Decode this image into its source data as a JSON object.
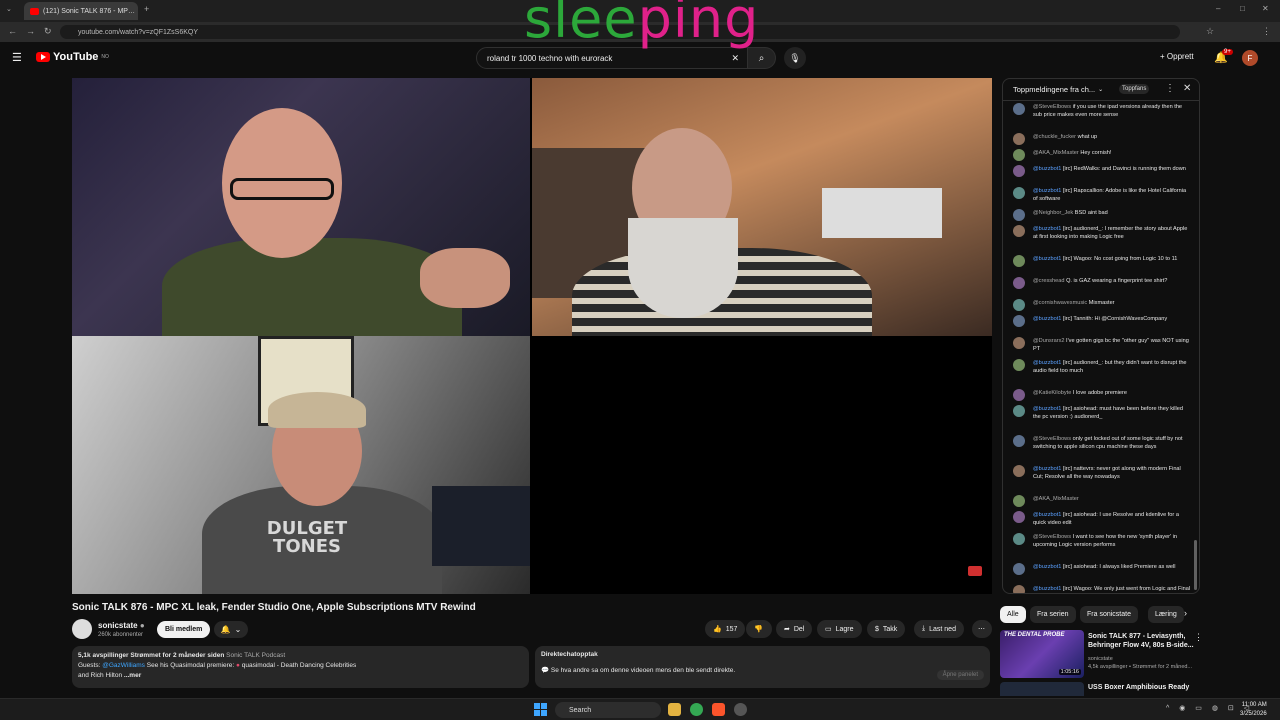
{
  "browser": {
    "tab_title": "(121) Sonic TALK 876 - MP…",
    "url": "youtube.com/watch?v=zQF1ZsS6KQY"
  },
  "overlay_text": {
    "part1": "slee",
    "part2": "ping"
  },
  "youtube": {
    "logo": "YouTube",
    "logo_region": "NO",
    "search_query": "roland tr 1000 techno with eurorack",
    "create_label": "Opprett",
    "notif_badge": "9+",
    "avatar_letter": "F"
  },
  "video": {
    "title": "Sonic TALK 876 - MPC XL leak, Fender Studio One, Apple Subscriptions MTV Rewind",
    "channel": "sonicstate",
    "subscribers": "260k abonnenter",
    "join_label": "Bli medlem",
    "likes": "157",
    "actions": {
      "share": "Del",
      "save": "Lagre",
      "thanks": "Takk",
      "download": "Last ned"
    }
  },
  "description": {
    "stats": "5,1k avspillinger  Strømmet for 2 måneder siden",
    "playlist": "Sonic TALK Podcast",
    "guests_label": "Guests:",
    "guest1": "@GazWilliams",
    "see_his": " See his Quasimodal premiere: ",
    "quasi": "quasimodal - Death Dancing Celebrities",
    "guest2_line": "and Rich Hilton",
    "more": "...mer"
  },
  "live_chat_replay": {
    "heading": "Direktechatopptak",
    "text": "Se hva andre sa om denne videoen mens den ble sendt direkte.",
    "open_label": "Åpne panelet"
  },
  "chat": {
    "header": "Toppmeldingene fra ch...",
    "fans_label": "Toppfans",
    "messages": [
      {
        "user": "@SteveElbows",
        "text": "if you use the ipad versions already then the sub price makes even more sense",
        "blue": false
      },
      {
        "user": "@chuckle_fucker",
        "text": "what up",
        "blue": false
      },
      {
        "user": "@AKA_MixMaster",
        "text": "Hey cornish!",
        "blue": false
      },
      {
        "user": "@buzzbot1",
        "text": "[irc] RedWalks: and Davinci is running them down",
        "blue": true
      },
      {
        "user": "@buzzbot1",
        "text": "[irc] Rapscallion: Adobe is like the Hotel California of software",
        "blue": true
      },
      {
        "user": "@Neighbor_Jek",
        "text": "BSD aint bad",
        "blue": false
      },
      {
        "user": "@buzzbot1",
        "text": "[irc] audionerd_: I remember the story about Apple at first looking into making Logic free",
        "blue": true
      },
      {
        "user": "@buzzbot1",
        "text": "[irc] Wagoo: No cost going from Logic 10 to 11",
        "blue": true
      },
      {
        "user": "@cresshead",
        "text": "Q. is GAZ wearing a fingerprint tee shirt?",
        "blue": false
      },
      {
        "user": "@cornishwavesmusic",
        "text": "Mixmaster",
        "blue": false
      },
      {
        "user": "@buzzbot1",
        "text": "[irc] Tannith: Hi @CornishWavesCompany",
        "blue": true
      },
      {
        "user": "@Dunsrarx2",
        "text": "I've gotten gigs bc the \"other guy\" was NOT using PT",
        "blue": false
      },
      {
        "user": "@buzzbot1",
        "text": "[irc] audionerd_: but they didn't want to disrupt the audio field too much",
        "blue": true
      },
      {
        "user": "@KatieKilobyte",
        "text": "I love adobe premiere",
        "blue": false
      },
      {
        "user": "@buzzbot1",
        "text": "[irc] asiohead: must have been before they killed the pc version :) audionerd_",
        "blue": true
      },
      {
        "user": "@SteveElbows",
        "text": "only get locked out of some logic stuff by not switching to apple silicon cpu machine these days",
        "blue": false
      },
      {
        "user": "@buzzbot1",
        "text": "[irc] nattevrs: never got along with modern Final Cut; Resolve all the way nowadays",
        "blue": true
      },
      {
        "user": "@AKA_MixMaster",
        "text": "",
        "blue": false
      },
      {
        "user": "@buzzbot1",
        "text": "[irc] asiohead: I use Resolve and kdenlive for a quick video edit",
        "blue": true
      },
      {
        "user": "@SteveElbows",
        "text": "I want to see how the new 'synth player' in upcoming Logic version performs",
        "blue": false
      },
      {
        "user": "@buzzbot1",
        "text": "[irc] asiohead: I always liked Premiere as well",
        "blue": true
      },
      {
        "user": "@buzzbot1",
        "text": "[irc] Wagoo: We only just went from Logic and Final Cut 10.x to 11.x - version 12 might be 10 years away",
        "blue": true
      },
      {
        "user": "@buzzbot1",
        "text": "[twitch] notturtlesoup: I think it is?",
        "blue": true
      },
      {
        "user": "@cresshead",
        "text": "rental = mental",
        "blue": false
      },
      {
        "user": "@asiohead",
        "text": "hehe",
        "blue": false
      }
    ]
  },
  "chips": [
    "Alle",
    "Fra serien",
    "Fra sonicstate",
    "Læring"
  ],
  "recommendations": [
    {
      "title": "Sonic TALK 877 - Leviasynth, Behringer Flow 4V, 80s B-side...",
      "channel": "sonicstate",
      "meta": "4,5k avspillinger • Strømmet for 2 måned...",
      "duration": "1:05:16",
      "thumb_text": "THE DENTAL PROBE"
    },
    {
      "title": "USS Boxer Amphibious Ready"
    }
  ],
  "taskbar": {
    "search": "Search",
    "time": "11:00 AM",
    "date": "3/25/2026"
  }
}
